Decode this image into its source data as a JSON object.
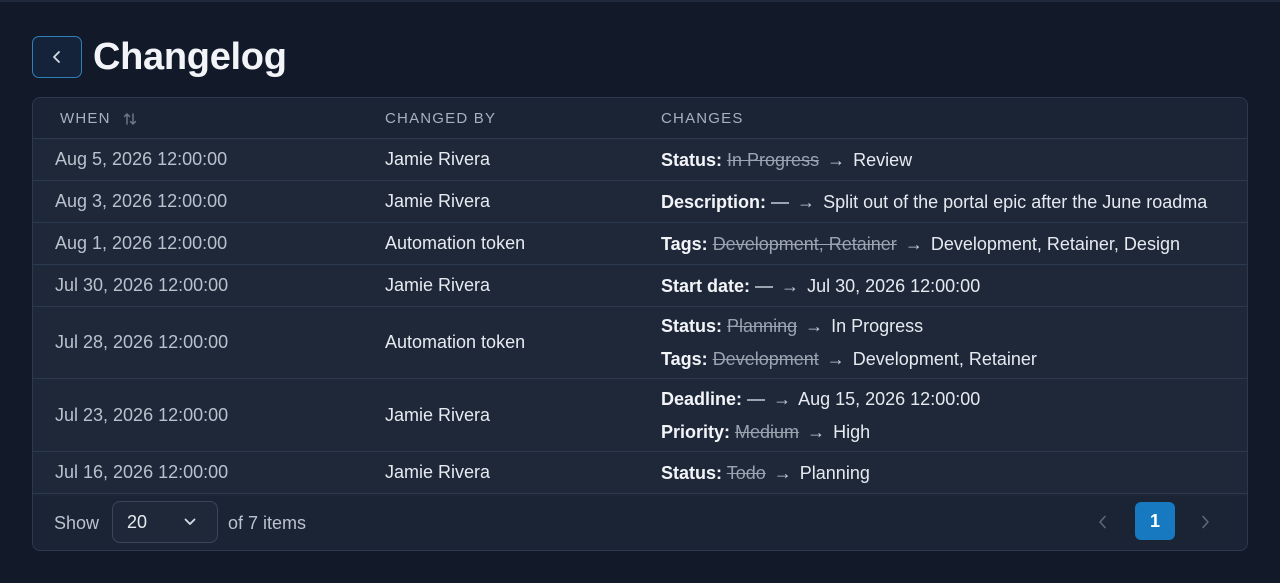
{
  "header": {
    "title": "Changelog"
  },
  "table": {
    "columns": {
      "when": "WHEN",
      "changed_by": "CHANGED BY",
      "changes": "CHANGES"
    },
    "rows": [
      {
        "when": "Aug 5, 2026 12:00:00",
        "changed_by": "Jamie Rivera",
        "changes": [
          {
            "field": "Status:",
            "old": "In Progress",
            "arrow": "→",
            "new": "Review"
          }
        ]
      },
      {
        "when": "Aug 3, 2026 12:00:00",
        "changed_by": "Jamie Rivera",
        "changes": [
          {
            "field": "Description:",
            "old": "—",
            "arrow": "→",
            "new": "Split out of the portal epic after the June roadma"
          }
        ]
      },
      {
        "when": "Aug 1, 2026 12:00:00",
        "changed_by": "Automation token",
        "changes": [
          {
            "field": "Tags:",
            "old": "Development, Retainer",
            "arrow": "→",
            "new": "Development, Retainer, Design"
          }
        ]
      },
      {
        "when": "Jul 30, 2026 12:00:00",
        "changed_by": "Jamie Rivera",
        "changes": [
          {
            "field": "Start date:",
            "old": "—",
            "arrow": "→",
            "new": "Jul 30, 2026 12:00:00"
          }
        ]
      },
      {
        "when": "Jul 28, 2026 12:00:00",
        "changed_by": "Automation token",
        "changes": [
          {
            "field": "Status:",
            "old": "Planning",
            "arrow": "→",
            "new": "In Progress"
          },
          {
            "field": "Tags:",
            "old": "Development",
            "arrow": "→",
            "new": "Development, Retainer"
          }
        ]
      },
      {
        "when": "Jul 23, 2026 12:00:00",
        "changed_by": "Jamie Rivera",
        "changes": [
          {
            "field": "Deadline:",
            "old": "—",
            "arrow": "→",
            "new": "Aug 15, 2026 12:00:00"
          },
          {
            "field": "Priority:",
            "old": "Medium",
            "arrow": "→",
            "new": "High"
          }
        ]
      },
      {
        "when": "Jul 16, 2026 12:00:00",
        "changed_by": "Jamie Rivera",
        "changes": [
          {
            "field": "Status:",
            "old": "Todo",
            "arrow": "→",
            "new": "Planning"
          }
        ]
      }
    ]
  },
  "footer": {
    "show_label": "Show",
    "page_size": "20",
    "items_count": "of 7 items",
    "current_page": "1"
  },
  "icons": {
    "back": "chevron-left-icon",
    "sort": "sort-icon",
    "dropdown": "chevron-down-icon",
    "prev": "chevron-left-icon",
    "next": "chevron-right-icon"
  },
  "colors": {
    "accent": "#1779bf",
    "background": "#121a2a",
    "surface": "#1d2737"
  }
}
